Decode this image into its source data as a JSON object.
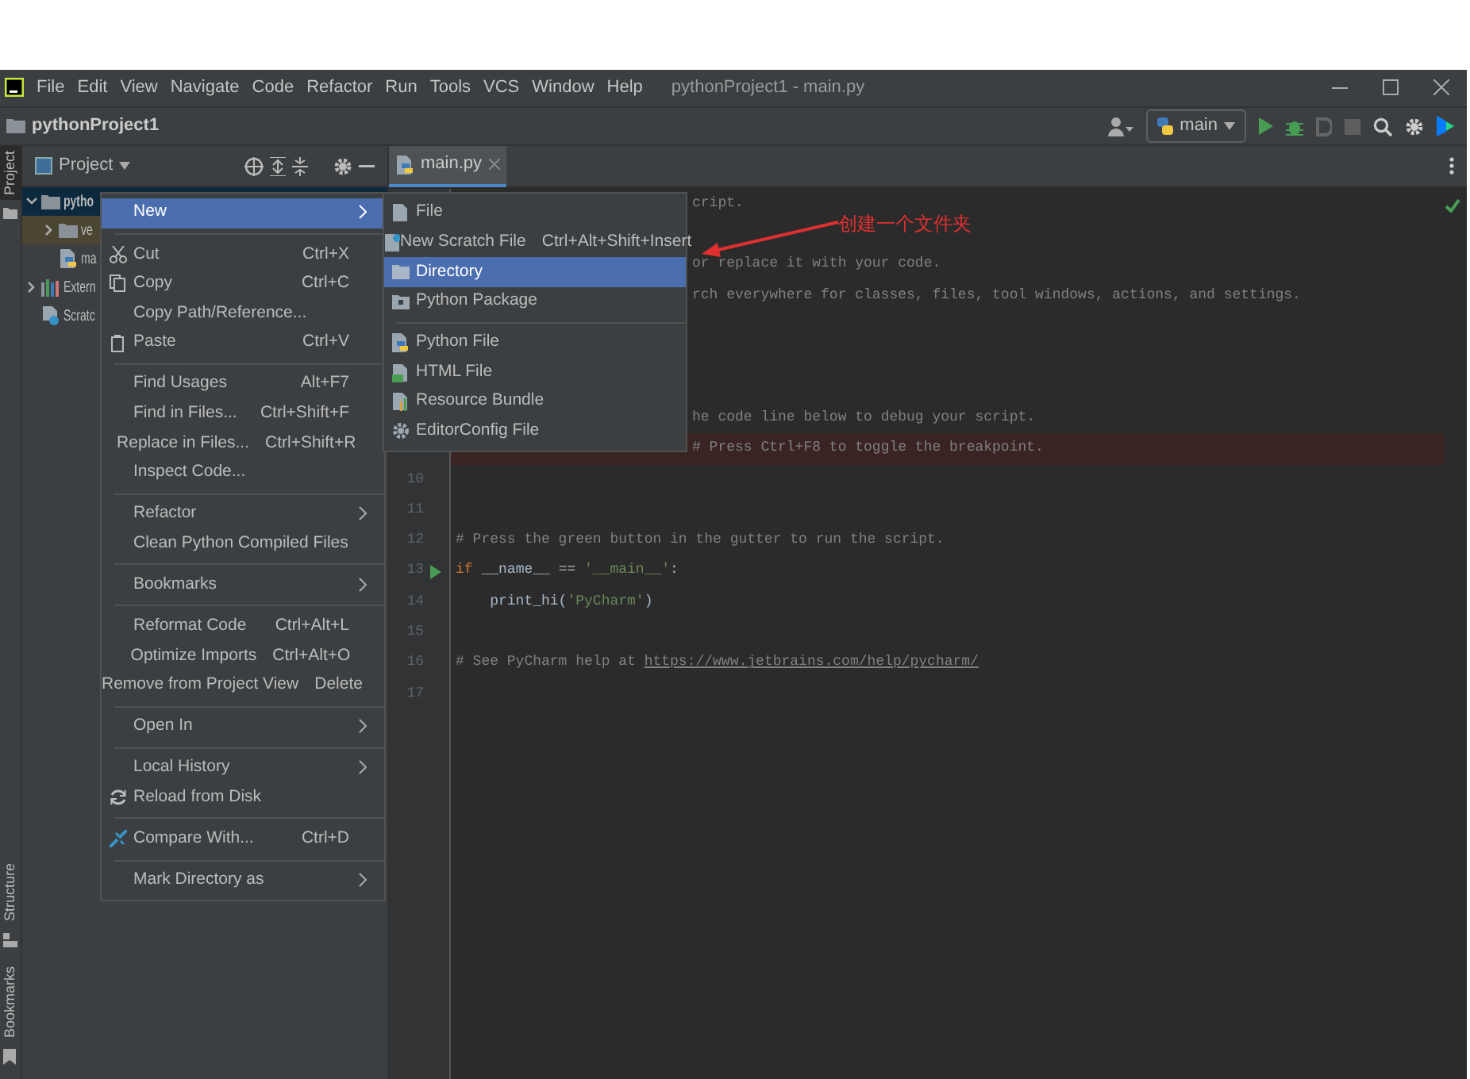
{
  "window": {
    "title": "pythonProject1 - main.py"
  },
  "menu_bar": [
    "File",
    "Edit",
    "View",
    "Navigate",
    "Code",
    "Refactor",
    "Run",
    "Tools",
    "VCS",
    "Window",
    "Help"
  ],
  "navigation": {
    "project": "pythonProject1",
    "run_config": "main"
  },
  "side_tabs_top": [
    {
      "label": "Project",
      "selected": true
    }
  ],
  "side_tabs_bottom": [
    {
      "label": "Structure",
      "selected": false
    },
    {
      "label": "Bookmarks",
      "selected": false
    }
  ],
  "project_panel": {
    "title": "Project",
    "tree": [
      {
        "label": "pytho",
        "kind": "folder",
        "expanded": true,
        "selected": true,
        "children": [
          {
            "label": "ve",
            "kind": "excluded-folder",
            "expanded": false,
            "selected": false
          },
          {
            "label": "ma",
            "kind": "python-file",
            "selected": false
          }
        ]
      },
      {
        "label": "Extern",
        "kind": "library",
        "expanded": false,
        "selected": false
      },
      {
        "label": "Scratc",
        "kind": "scratches",
        "selected": false
      }
    ]
  },
  "editor": {
    "tabs": [
      {
        "label": "main.py",
        "selected": true
      }
    ],
    "lines": [
      {
        "kind": "hidden-start",
        "breakpoint": false,
        "run_marker": false,
        "tokens": [
          {
            "kind": "comment",
            "text": "cript."
          }
        ]
      },
      {
        "kind": "hidden-start",
        "breakpoint": false,
        "run_marker": false
      },
      {
        "kind": "hidden-start",
        "breakpoint": false,
        "run_marker": false,
        "tokens": [
          {
            "kind": "comment",
            "text": "or replace it with your code."
          }
        ]
      },
      {
        "kind": "hidden-start",
        "breakpoint": false,
        "run_marker": false,
        "tokens": [
          {
            "kind": "comment",
            "text": "rch everywhere for classes, files, tool windows, actions, and settings."
          }
        ]
      },
      {
        "kind": "hidden-start",
        "breakpoint": false,
        "run_marker": false
      },
      {
        "kind": "hidden-start",
        "breakpoint": false,
        "run_marker": false
      },
      {
        "kind": "hidden-start",
        "breakpoint": false,
        "run_marker": false
      },
      {
        "kind": "hidden-start",
        "breakpoint": false,
        "run_marker": false,
        "tokens": [
          {
            "kind": "comment",
            "text": "he code line below to debug your script."
          }
        ]
      },
      {
        "kind": "hidden-start",
        "breakpoint": true,
        "run_marker": false,
        "tokens": [
          {
            "kind": "comment",
            "text": "# Press Ctrl+F8 to toggle the breakpoint."
          }
        ]
      },
      {
        "kind": "full",
        "number": "10",
        "breakpoint": false,
        "run_marker": false
      },
      {
        "kind": "full",
        "number": "11",
        "breakpoint": false,
        "run_marker": false
      },
      {
        "kind": "full",
        "number": "12",
        "breakpoint": false,
        "run_marker": false,
        "tokens": [
          {
            "kind": "comment",
            "text": "# Press the green button in the gutter to run the script."
          }
        ]
      },
      {
        "kind": "full",
        "number": "13",
        "breakpoint": false,
        "run_marker": true,
        "tokens": [
          {
            "kind": "keyword",
            "text": "if"
          },
          {
            "kind": "plain",
            "text": " __name__ == "
          },
          {
            "kind": "string",
            "text": "'__main__'"
          },
          {
            "kind": "plain",
            "text": ":"
          }
        ]
      },
      {
        "kind": "full",
        "number": "14",
        "breakpoint": false,
        "run_marker": false,
        "tokens": [
          {
            "kind": "plain",
            "text": "    print_hi("
          },
          {
            "kind": "string",
            "text": "'PyCharm'"
          },
          {
            "kind": "plain",
            "text": ")"
          }
        ]
      },
      {
        "kind": "full",
        "number": "15",
        "breakpoint": false,
        "run_marker": false
      },
      {
        "kind": "full",
        "number": "16",
        "breakpoint": false,
        "run_marker": false,
        "tokens": [
          {
            "kind": "comment",
            "text": "# See PyCharm help at "
          },
          {
            "kind": "link",
            "text": "https://www.jetbrains.com/help/pycharm/"
          }
        ]
      },
      {
        "kind": "full",
        "number": "17",
        "breakpoint": false,
        "run_marker": false
      }
    ]
  },
  "context_menu": {
    "items": [
      {
        "kind": "item",
        "label": "New",
        "has_submenu": true,
        "selected": true
      },
      {
        "kind": "separator"
      },
      {
        "kind": "item",
        "label": "Cut",
        "shortcut": "Ctrl+X",
        "has_submenu": false,
        "selected": false
      },
      {
        "kind": "item",
        "label": "Copy",
        "shortcut": "Ctrl+C",
        "has_submenu": false,
        "selected": false
      },
      {
        "kind": "item",
        "label": "Copy Path/Reference...",
        "has_submenu": false,
        "selected": false
      },
      {
        "kind": "item",
        "label": "Paste",
        "shortcut": "Ctrl+V",
        "has_submenu": false,
        "selected": false
      },
      {
        "kind": "separator"
      },
      {
        "kind": "item",
        "label": "Find Usages",
        "shortcut": "Alt+F7",
        "has_submenu": false,
        "selected": false
      },
      {
        "kind": "item",
        "label": "Find in Files...",
        "shortcut": "Ctrl+Shift+F",
        "has_submenu": false,
        "selected": false
      },
      {
        "kind": "item",
        "label": "Replace in Files...",
        "shortcut": "Ctrl+Shift+R",
        "has_submenu": false,
        "selected": false
      },
      {
        "kind": "item",
        "label": "Inspect Code...",
        "has_submenu": false,
        "selected": false
      },
      {
        "kind": "separator"
      },
      {
        "kind": "item",
        "label": "Refactor",
        "has_submenu": true,
        "selected": false
      },
      {
        "kind": "item",
        "label": "Clean Python Compiled Files",
        "has_submenu": false,
        "selected": false
      },
      {
        "kind": "separator"
      },
      {
        "kind": "item",
        "label": "Bookmarks",
        "has_submenu": true,
        "selected": false
      },
      {
        "kind": "separator"
      },
      {
        "kind": "item",
        "label": "Reformat Code",
        "shortcut": "Ctrl+Alt+L",
        "has_submenu": false,
        "selected": false
      },
      {
        "kind": "item",
        "label": "Optimize Imports",
        "shortcut": "Ctrl+Alt+O",
        "has_submenu": false,
        "selected": false
      },
      {
        "kind": "item",
        "label": "Remove from Project View",
        "shortcut": "Delete",
        "has_submenu": false,
        "selected": false
      },
      {
        "kind": "separator"
      },
      {
        "kind": "item",
        "label": "Open In",
        "has_submenu": true,
        "selected": false
      },
      {
        "kind": "separator"
      },
      {
        "kind": "item",
        "label": "Local History",
        "has_submenu": true,
        "selected": false
      },
      {
        "kind": "item",
        "label": "Reload from Disk",
        "has_submenu": false,
        "selected": false
      },
      {
        "kind": "separator"
      },
      {
        "kind": "item",
        "label": "Compare With...",
        "shortcut": "Ctrl+D",
        "has_submenu": false,
        "selected": false
      },
      {
        "kind": "separator"
      },
      {
        "kind": "item",
        "label": "Mark Directory as",
        "has_submenu": true,
        "selected": false
      }
    ]
  },
  "new_submenu": {
    "items": [
      {
        "kind": "item",
        "label": "File",
        "selected": false
      },
      {
        "kind": "item",
        "label": "New Scratch File",
        "shortcut": "Ctrl+Alt+Shift+Insert",
        "selected": false
      },
      {
        "kind": "item",
        "label": "Directory",
        "selected": true
      },
      {
        "kind": "item",
        "label": "Python Package",
        "selected": false
      },
      {
        "kind": "separator"
      },
      {
        "kind": "item",
        "label": "Python File",
        "selected": false
      },
      {
        "kind": "item",
        "label": "HTML File",
        "selected": false
      },
      {
        "kind": "item",
        "label": "Resource Bundle",
        "selected": false
      },
      {
        "kind": "item",
        "label": "EditorConfig File",
        "selected": false
      }
    ]
  },
  "annotation": {
    "text": "创建一个文件夹"
  }
}
